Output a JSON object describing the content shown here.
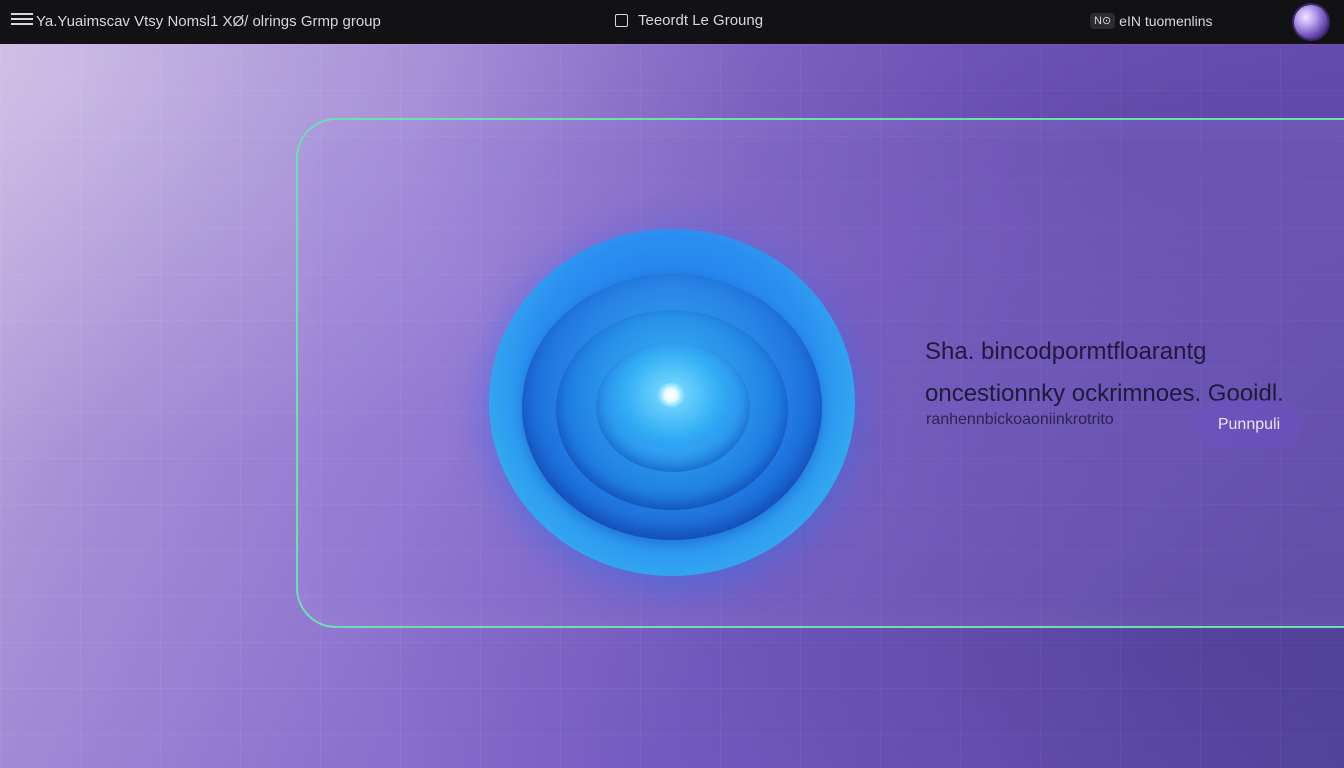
{
  "topbar": {
    "app_title": "Ya.Yuaimscav Vtsy Nomsl1 XØ/ olrings Grmp group",
    "center_label": "Teeordt Le Groung",
    "status_pill": "N⊙",
    "status_text": "eIN tuomenlins"
  },
  "hero": {
    "headline_line1": "Sha. bincodpormtfloarantg",
    "headline_line2": "oncestionnky ockrimnoes. Gooidl.",
    "subtext": "ranhennbickoaoniinkrotrito",
    "button_label": "Punnpuli"
  },
  "colors": {
    "topbar_bg": "#121214",
    "card_border": "#6ee0b0",
    "orb_primary": "#2a8ef0",
    "orb_highlight": "#3fd0f0"
  },
  "icons": [
    "menu-icon",
    "window-icon",
    "avatar-icon"
  ]
}
